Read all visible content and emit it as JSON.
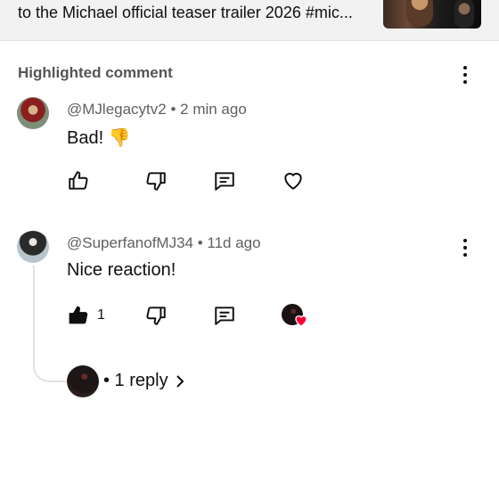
{
  "video": {
    "title": "to the Michael official teaser trailer 2026 #mic..."
  },
  "section": {
    "header": "Highlighted comment"
  },
  "comments": [
    {
      "author_meta": "@MJlegacytv2 • 2 min ago",
      "text": "Bad! 👎",
      "like_count": ""
    },
    {
      "author_meta": "@SuperfanofMJ34 • 11d ago",
      "text": "Nice reaction!",
      "like_count": "1",
      "replies_label": "• 1 reply"
    }
  ],
  "icons": {
    "like": "thumbs-up-icon",
    "dislike": "thumbs-down-icon",
    "reply": "comment-icon",
    "heart": "heart-icon",
    "more": "more-vert-icon",
    "chevron": "chevron-right-icon"
  },
  "colors": {
    "heart_red": "#ff0033",
    "text_primary": "#0f0f0f",
    "text_secondary": "#606060"
  }
}
